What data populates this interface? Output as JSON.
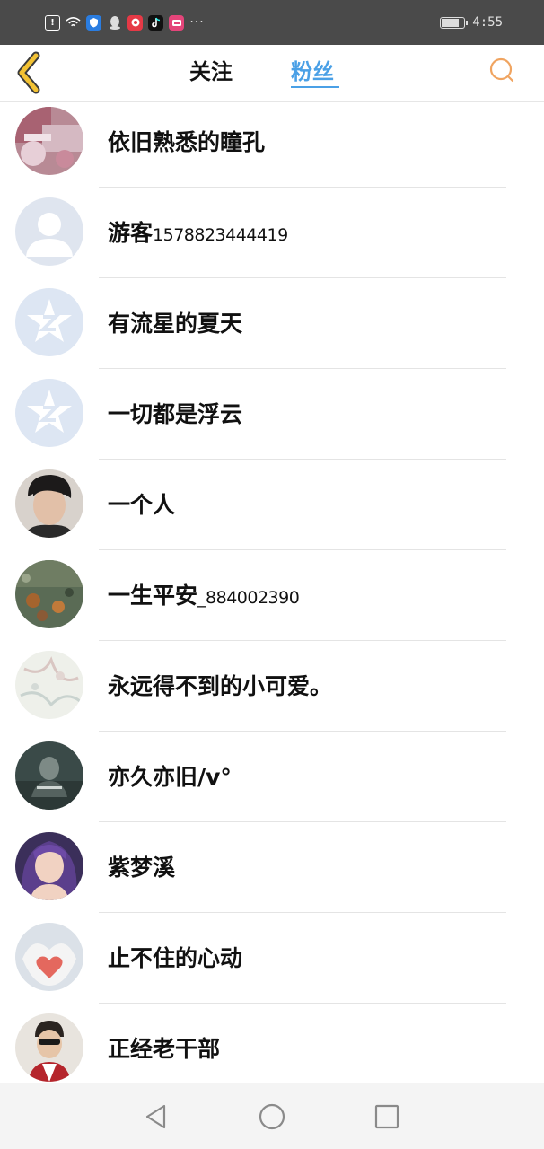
{
  "status_bar": {
    "time": "4:55",
    "battery_level": 0.85,
    "icons": [
      "alert-icon",
      "wifi-icon",
      "shield-app-icon",
      "qq-icon",
      "music-app-icon",
      "tiktok-icon",
      "video-app-icon",
      "more-icon"
    ],
    "more_text": "···"
  },
  "header": {
    "tabs": [
      {
        "label": "关注",
        "active": false
      },
      {
        "label": "粉丝",
        "active": true
      }
    ],
    "accent_color": "#4aa0e6",
    "back_icon": "chevron-left-icon",
    "search_icon": "search-icon"
  },
  "fans": [
    {
      "name": "依旧熟悉的瞳孔",
      "suffix": ""
    },
    {
      "name": "游客",
      "suffix": "1578823444419"
    },
    {
      "name": "有流星的夏天",
      "suffix": ""
    },
    {
      "name": "一切都是浮云",
      "suffix": ""
    },
    {
      "name": "一个人",
      "suffix": ""
    },
    {
      "name": "一生平安",
      "suffix": "_884002390"
    },
    {
      "name": "永远得不到的小可爱。",
      "suffix": ""
    },
    {
      "name": "亦久亦旧/v°",
      "suffix": ""
    },
    {
      "name": "紫梦溪",
      "suffix": ""
    },
    {
      "name": "止不住的心动",
      "suffix": ""
    },
    {
      "name": "正经老干部",
      "suffix": ""
    }
  ],
  "nav_bar": {
    "icons": [
      "nav-back-icon",
      "nav-home-icon",
      "nav-recent-icon"
    ]
  }
}
